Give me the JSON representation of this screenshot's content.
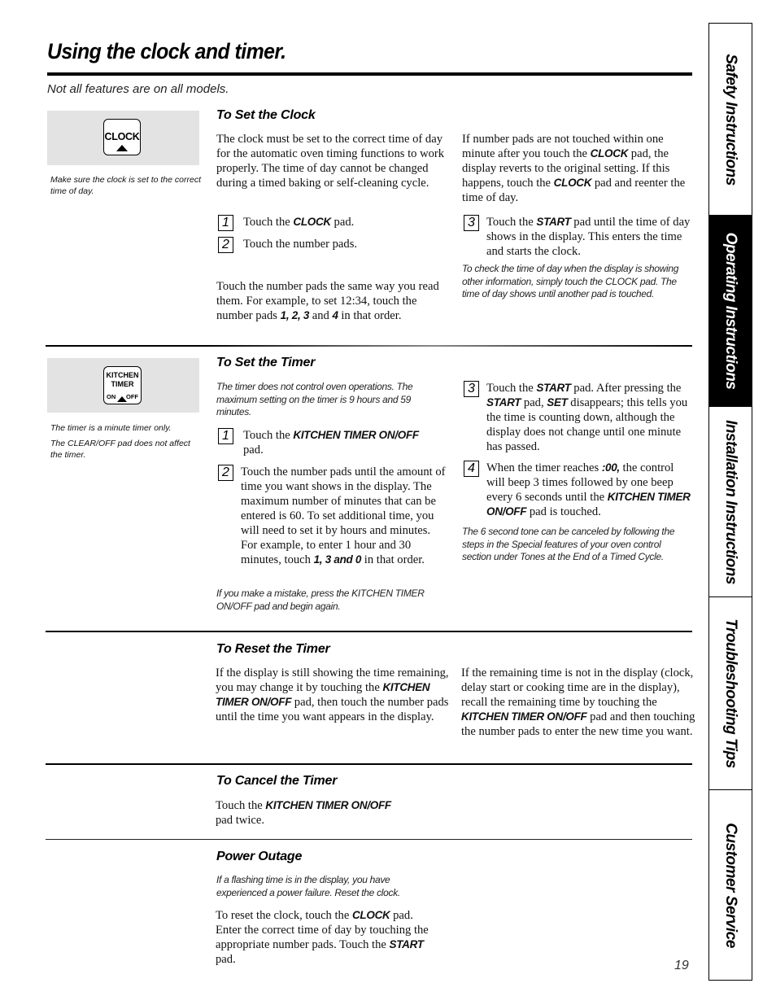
{
  "page": {
    "title": "Using the clock and timer.",
    "subtitle": "Not all features are on all models.",
    "page_number": "19"
  },
  "side_tabs": [
    {
      "label": "Safety Instructions",
      "active": false
    },
    {
      "label": "Operating Instructions",
      "active": true
    },
    {
      "label": "Installation Instructions",
      "active": false
    },
    {
      "label": "Troubleshooting Tips",
      "active": false
    },
    {
      "label": "Customer Service",
      "active": false
    }
  ],
  "clock_section": {
    "pad_icon": {
      "label": "CLOCK",
      "icon": "clock-pad-icon"
    },
    "sidenote": "Make sure the clock is set to the correct time of day.",
    "heading": "To Set the Clock",
    "intro": "The clock must be set to the correct time of day for the automatic oven timing functions to work properly. The time of day cannot be changed during a timed baking or self-cleaning cycle.",
    "steps": [
      {
        "num": "1",
        "pre": "Touch the ",
        "kw": "CLOCK",
        "post": " pad."
      },
      {
        "num": "2",
        "pre": "Touch the number pads.",
        "kw": "",
        "post": ""
      },
      {
        "num": "3",
        "pre": "Touch the ",
        "kw": "START",
        "post": " pad until the time of day shows in the display. This enters the time and starts the clock."
      }
    ],
    "example": {
      "pre": "Touch the number pads the same way you read them. For example, to set 12:34, touch the number pads ",
      "kw1": "1, 2, 3",
      "mid": " and ",
      "kw2": "4",
      "post": " in that order."
    },
    "revert": {
      "p1": "If number pads are not touched within one minute after you touch the ",
      "kw1": "CLOCK",
      "p2": " pad, the display reverts to the original setting. If this happens, touch the ",
      "kw2": "CLOCK",
      "p3": " pad and reenter the time of day."
    },
    "note": "To check the time of day when the display is showing other information, simply touch the CLOCK pad. The time of day shows until another pad is touched."
  },
  "timer_section": {
    "pad_icon": {
      "line1": "KITCHEN",
      "line2": "TIMER",
      "on": "ON",
      "off": "OFF",
      "icon": "kitchen-timer-pad-icon"
    },
    "sidenotes": [
      "The timer is a minute timer only.",
      "The CLEAR/OFF pad does not affect the timer."
    ],
    "heading": "To Set the Timer",
    "intro_note": "The timer does not control oven operations. The maximum setting on the timer is 9 hours and 59 minutes.",
    "step1": {
      "num": "1",
      "pre": "Touch the ",
      "kw": "KITCHEN TIMER ON/OFF",
      "post": " pad."
    },
    "step2": {
      "num": "2",
      "pre": "Touch the number pads until the amount of time you want shows in the display. The maximum number of minutes that can be entered is 60. To set additional time, you will need to set it by hours and minutes. For example, to enter 1 hour and 30 minutes, touch ",
      "kw": "1, 3 and 0",
      "post": " in that order."
    },
    "mistake_note": "If you make a mistake, press the KITCHEN TIMER ON/OFF pad and begin again.",
    "step3": {
      "num": "3",
      "p1": "Touch the ",
      "kw1": "START",
      "p2": " pad. After pressing the ",
      "kw2": "START",
      "p3": " pad, ",
      "kw3": "SET",
      "p4": " disappears; this tells you the time is counting down, although the display does not change until one minute has passed."
    },
    "step4": {
      "num": "4",
      "p1": "When the timer reaches ",
      "kw1": ":00,",
      "p2": " the control will beep 3 times followed by one beep every 6 seconds until the ",
      "kw2": "KITCHEN TIMER ON/OFF",
      "p3": " pad is touched."
    },
    "tone_note": "The 6 second tone can be canceled by following the steps in the Special features of your oven control section under Tones at the End of a Timed Cycle."
  },
  "reset_section": {
    "heading": "To Reset the Timer",
    "left": {
      "p1": "If the display is still showing the time remaining, you may change it by touching the ",
      "kw": "KITCHEN TIMER ON/OFF",
      "p2": " pad, then touch the number pads until the time you want appears in the display."
    },
    "right": {
      "p1": "If the remaining time is not in the display (clock, delay start or cooking time are in the display), recall the remaining time by touching the ",
      "kw": "KITCHEN TIMER ON/OFF",
      "p2": " pad and then touching the number pads to enter the new time you want."
    }
  },
  "cancel_section": {
    "heading": "To Cancel the Timer",
    "text": {
      "p1": "Touch the ",
      "kw": "KITCHEN TIMER ON/OFF",
      "p2": " pad twice."
    }
  },
  "power_section": {
    "heading": "Power Outage",
    "note": "If a flashing time is in the display, you have experienced a power failure. Reset the clock.",
    "text": {
      "p1": "To reset the clock, touch the ",
      "kw1": "CLOCK",
      "p2": " pad. Enter the correct time of day by touching the appropriate number pads. Touch the ",
      "kw2": "START",
      "p3": " pad."
    }
  }
}
